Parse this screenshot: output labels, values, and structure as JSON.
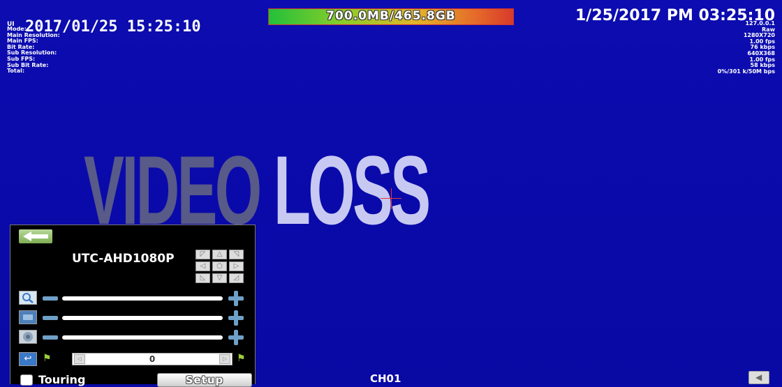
{
  "overlay": {
    "ui_tag": "UI",
    "datetime_left": "2017/01/25 15:25:10",
    "datetime_right": "1/25/2017 PM 03:25:10",
    "storage": "700.0MB/465.8GB",
    "info_labels": [
      "Mode:",
      "Main Resolution:",
      "Main FPS:",
      "Bit Rate:",
      "Sub Resolution:",
      "Sub FPS:",
      "Sub Bit Rate:",
      "Total:"
    ],
    "info_values": [
      "127.0.0.1",
      "Raw",
      "1280X720",
      "1.00 fps",
      "76 kbps",
      "640X368",
      "1.00 fps",
      "58 kbps",
      "0%/301 k/50M bps"
    ]
  },
  "video": {
    "word1": "VIDEO",
    "word2": "LOSS"
  },
  "ptz": {
    "camera_name": "UTC-AHD1080P",
    "preset_value": "0",
    "touring_label": "Touring",
    "setup_label": "Setup",
    "icons": {
      "back": "back-arrow-icon",
      "zoom": "zoom-icon",
      "focus": "focus-icon",
      "iris": "iris-icon",
      "undo": "undo-icon",
      "flag": "flag-icon"
    }
  },
  "footer": {
    "channel": "CH01"
  },
  "colors": {
    "background": "#0a0aa8",
    "video_word1": "#585a88",
    "video_word2": "#c7c9f2",
    "accent": "#6fa0c8"
  }
}
